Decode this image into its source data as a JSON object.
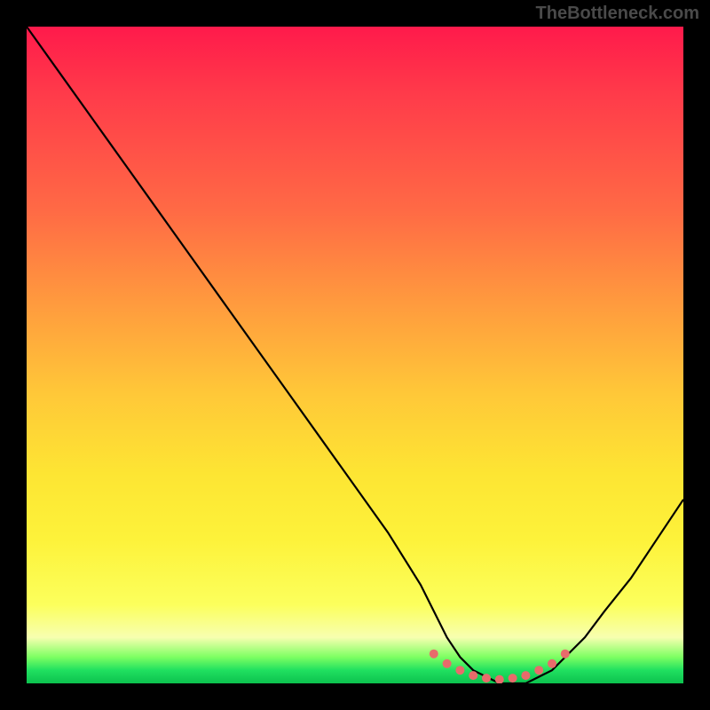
{
  "watermark": "TheBottleneck.com",
  "chart_data": {
    "type": "line",
    "title": "",
    "xlabel": "",
    "ylabel": "",
    "xlim": [
      0,
      100
    ],
    "ylim": [
      0,
      100
    ],
    "series": [
      {
        "name": "bottleneck-curve",
        "x": [
          0,
          5,
          10,
          15,
          20,
          25,
          30,
          35,
          40,
          45,
          50,
          55,
          60,
          62,
          64,
          66,
          68,
          70,
          72,
          74,
          76,
          78,
          80,
          82,
          85,
          88,
          92,
          96,
          100
        ],
        "values": [
          100,
          93,
          86,
          79,
          72,
          65,
          58,
          51,
          44,
          37,
          30,
          23,
          15,
          11,
          7,
          4,
          2,
          1,
          0,
          0,
          0,
          1,
          2,
          4,
          7,
          11,
          16,
          22,
          28
        ]
      }
    ],
    "highlight": {
      "name": "flat-zone-dots",
      "x": [
        62,
        64,
        66,
        68,
        70,
        72,
        74,
        76,
        78,
        80,
        82
      ],
      "values": [
        4.5,
        3.0,
        2.0,
        1.2,
        0.8,
        0.6,
        0.8,
        1.2,
        2.0,
        3.0,
        4.5
      ],
      "color": "#e86b6b"
    },
    "gradient_stops": [
      {
        "pct": 0,
        "color": "#ff1a4b"
      },
      {
        "pct": 28,
        "color": "#ff6a45"
      },
      {
        "pct": 56,
        "color": "#ffc838"
      },
      {
        "pct": 78,
        "color": "#fdf23a"
      },
      {
        "pct": 93,
        "color": "#f7ffb0"
      },
      {
        "pct": 98,
        "color": "#20e060"
      },
      {
        "pct": 100,
        "color": "#0cc24e"
      }
    ]
  }
}
